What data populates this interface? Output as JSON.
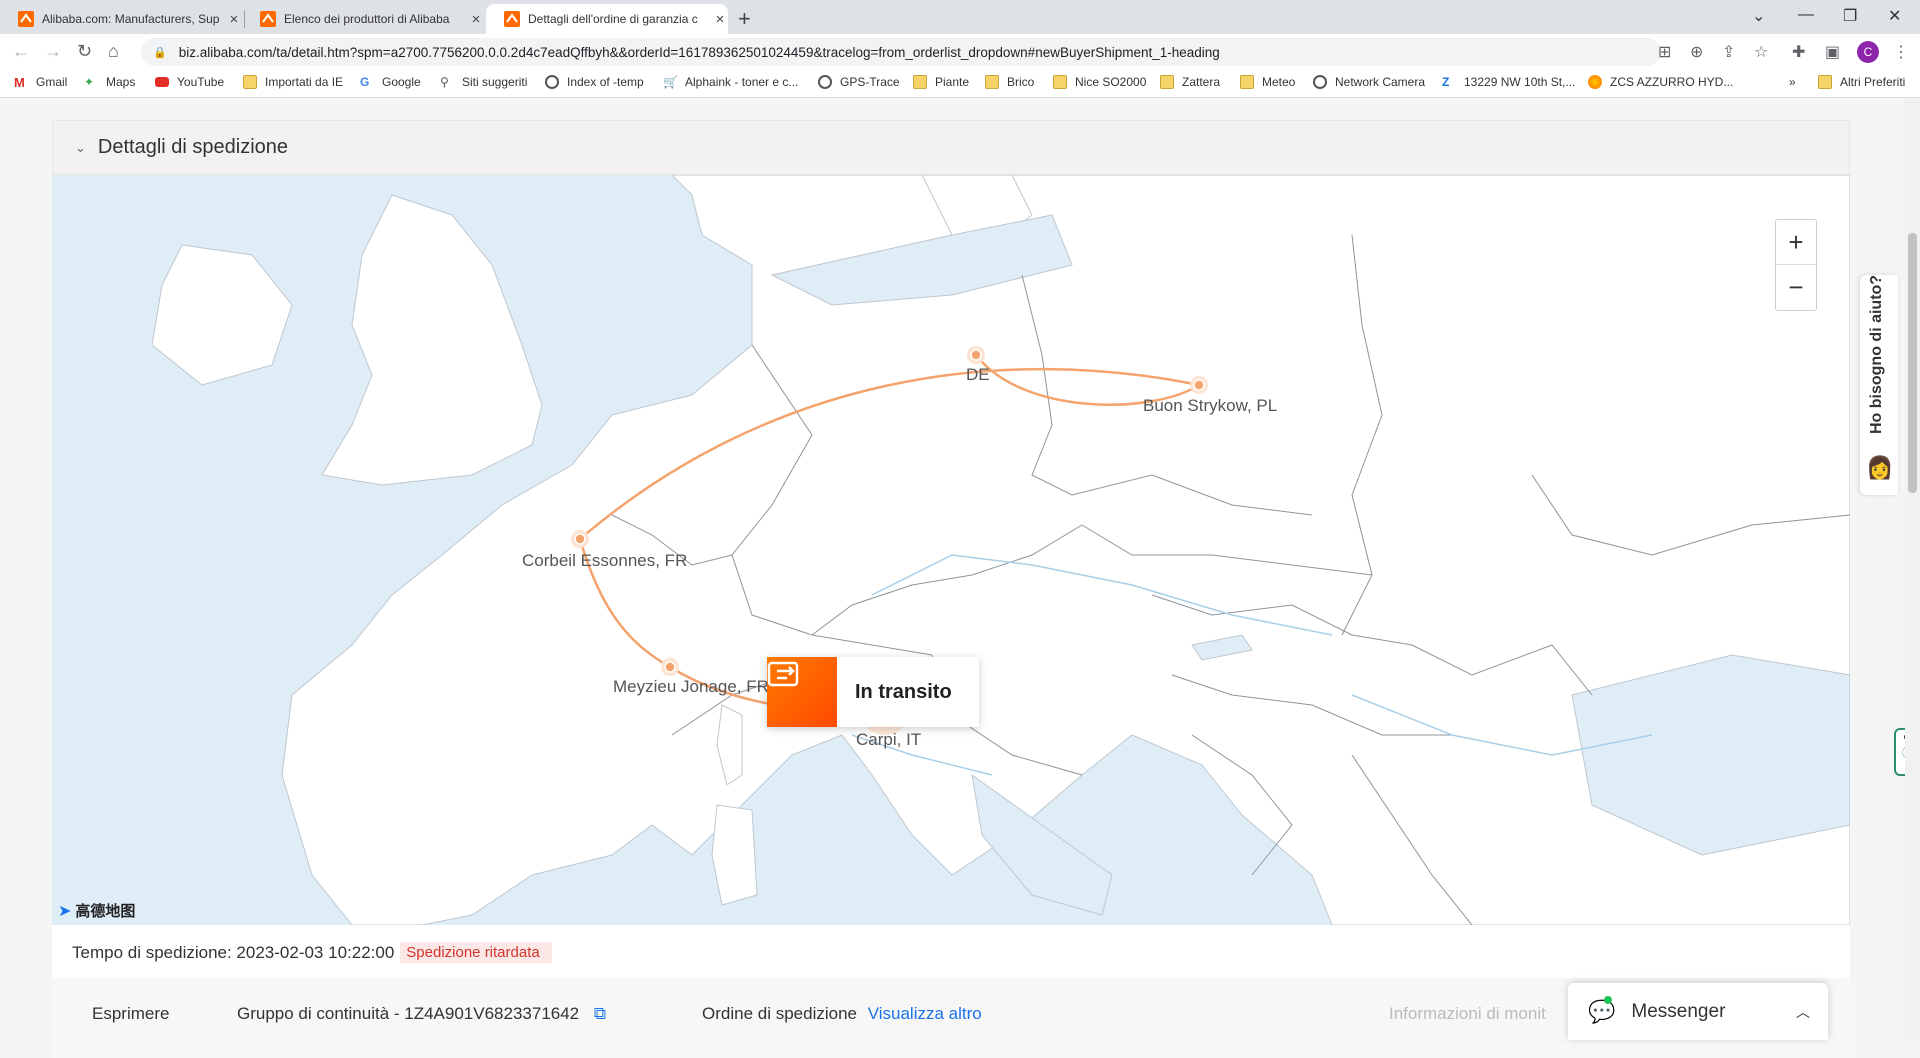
{
  "browser": {
    "tabs": [
      {
        "title": "Alibaba.com: Manufacturers, Sup",
        "active": false
      },
      {
        "title": "Elenco dei produttori di Alibaba",
        "active": false
      },
      {
        "title": "Dettagli dell'ordine di garanzia c",
        "active": true
      }
    ],
    "url": "biz.alibaba.com/ta/detail.htm?spm=a2700.7756200.0.0.2d4c7eadQffbyh&&orderId=161789362501024459&tracelog=from_orderlist_dropdown#newBuyerShipment_1-heading",
    "profile_initial": "C",
    "bookmarks": [
      {
        "label": "Gmail",
        "icon": "gmail-icon"
      },
      {
        "label": "Maps",
        "icon": "maps-icon"
      },
      {
        "label": "YouTube",
        "icon": "youtube-icon"
      },
      {
        "label": "Importati da IE",
        "icon": "folder-icon"
      },
      {
        "label": "Google",
        "icon": "google-icon"
      },
      {
        "label": "Siti suggeriti",
        "icon": "search-icon"
      },
      {
        "label": "Index of -temp",
        "icon": "globe-icon"
      },
      {
        "label": "Alphaink - toner e c...",
        "icon": "cart-icon"
      },
      {
        "label": "GPS-Trace",
        "icon": "globe-icon"
      },
      {
        "label": "Piante",
        "icon": "folder-icon"
      },
      {
        "label": "Brico",
        "icon": "folder-icon"
      },
      {
        "label": "Nice SO2000",
        "icon": "folder-icon"
      },
      {
        "label": "Zattera",
        "icon": "folder-icon"
      },
      {
        "label": "Meteo",
        "icon": "folder-icon"
      },
      {
        "label": "Network Camera",
        "icon": "globe-icon"
      },
      {
        "label": "13229 NW 10th St,...",
        "icon": "zillow-icon"
      },
      {
        "label": "ZCS AZZURRO HYD...",
        "icon": "zcs-icon"
      }
    ],
    "more_bookmarks": "»",
    "other_bookmarks": "Altri Preferiti"
  },
  "shipment": {
    "section_title": "Dettagli di spedizione",
    "map": {
      "zoom_in": "+",
      "zoom_out": "−",
      "locations": [
        {
          "label": "DE"
        },
        {
          "label": "Buon Strykow, PL"
        },
        {
          "label": "Corbeil Essonnes, FR"
        },
        {
          "label": "Meyzieu Jonage, FR"
        },
        {
          "label": "Carpi, IT"
        }
      ],
      "status": "In transito",
      "provider_logo": "高德地图",
      "route_color": "#f5a36c",
      "current_color": "#ff6a00"
    },
    "time_label": "Tempo di spedizione: 2023-02-03 10:22:00",
    "delay_badge": "Spedizione ritardata",
    "columns": {
      "carrier": "Esprimere",
      "tracking": "Gruppo di continuità - 1Z4A901V6823371642",
      "order_label": "Ordine di spedizione",
      "order_link": "Visualizza altro",
      "monitor": "Informazioni di monit"
    }
  },
  "help": {
    "label": "Ho bisogno di aiuto?"
  },
  "messenger": {
    "label": "Messenger"
  }
}
